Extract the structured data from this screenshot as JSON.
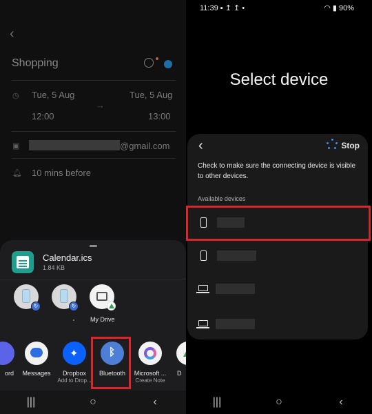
{
  "left": {
    "event": {
      "title": "Shopping",
      "start_date": "Tue, 5 Aug",
      "end_date": "Tue, 5 Aug",
      "start_time": "12:00",
      "end_time": "13:00",
      "account_suffix": "@gmail.com",
      "reminder": "10 mins before"
    },
    "share_sheet": {
      "file_name": "Calendar.ics",
      "file_size": "1.84 KB",
      "nearby": [
        {
          "label": ""
        },
        {
          "label": ""
        },
        {
          "label": "My Drive"
        }
      ],
      "apps": [
        {
          "label": "ord",
          "sub": "",
          "color": "#5b63e8"
        },
        {
          "label": "Messages",
          "sub": "",
          "color": "#f2f2f2"
        },
        {
          "label": "Dropbox",
          "sub": "Add to Drop...",
          "color": "#0b61fe"
        },
        {
          "label": "Bluetooth",
          "sub": "",
          "color": "#4e7fd6"
        },
        {
          "label": "Microsoft ...",
          "sub": "Create Note",
          "color": "#f2f2f2"
        },
        {
          "label": "D",
          "sub": "",
          "color": "#f2f2f2"
        }
      ]
    }
  },
  "right": {
    "status": {
      "time": "11:39",
      "battery": "90%"
    },
    "title": "Select device",
    "stop_label": "Stop",
    "hint": "Check to make sure the connecting device is visible to other devices.",
    "available_label": "Available devices",
    "devices": [
      {
        "type": "phone",
        "name": ""
      },
      {
        "type": "phone",
        "name": ""
      },
      {
        "type": "laptop",
        "name": ""
      },
      {
        "type": "laptop",
        "name": ""
      }
    ]
  },
  "colors": {
    "highlight": "#d8262c",
    "accent": "#3e8df0"
  }
}
